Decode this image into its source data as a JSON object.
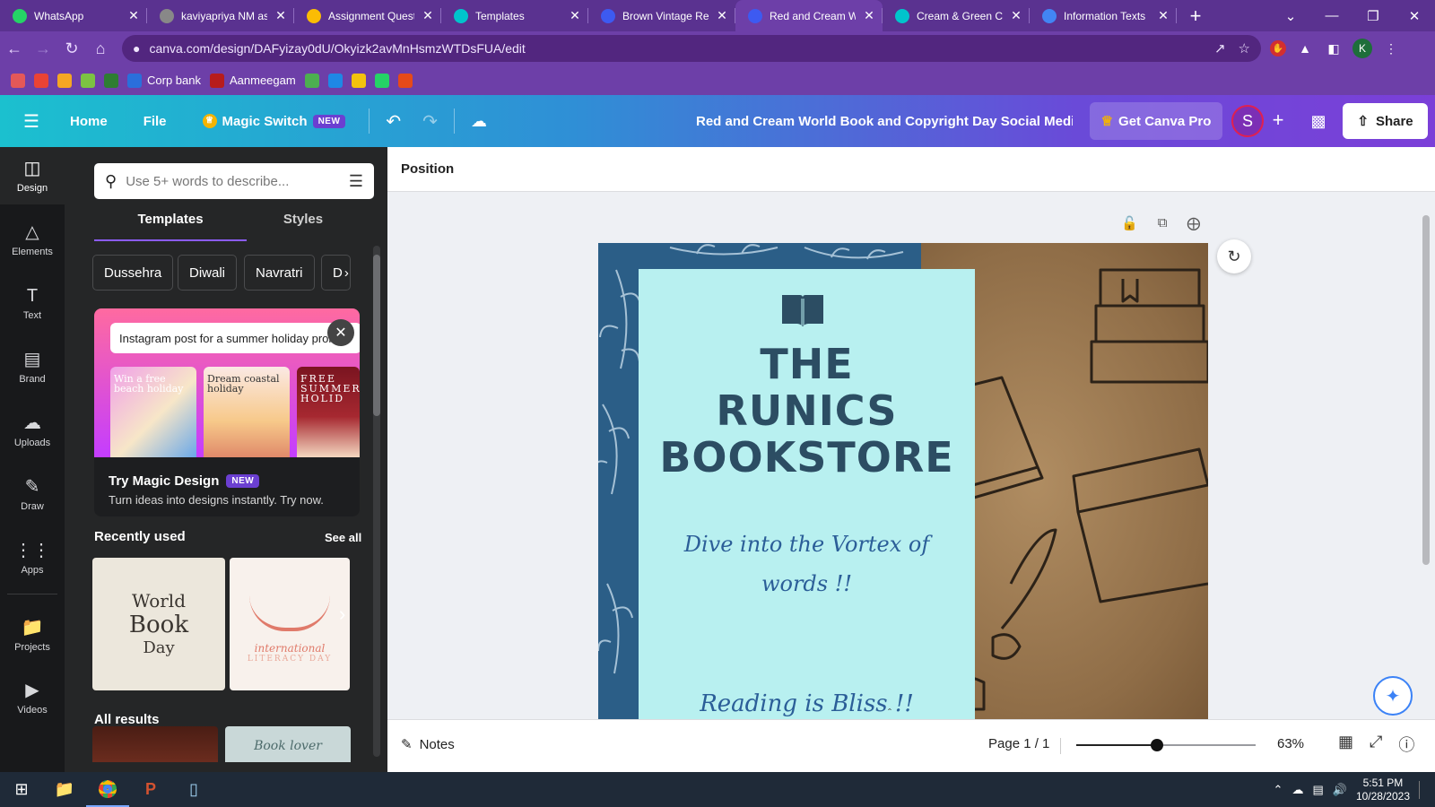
{
  "browser": {
    "tabs": [
      {
        "title": "WhatsApp",
        "icon": "whatsapp-icon",
        "color": "#25d366"
      },
      {
        "title": "kaviyapriya NM as",
        "icon": "globe-icon",
        "color": "#888888"
      },
      {
        "title": "Assignment Quest",
        "icon": "drive-icon",
        "color": "#fbbc04"
      },
      {
        "title": "Templates",
        "icon": "canva-icon",
        "color": "#00c4cc"
      },
      {
        "title": "Brown Vintage Ret",
        "icon": "heart-shield-icon",
        "color": "#3d5af1"
      },
      {
        "title": "Red and Cream W",
        "icon": "heart-shield-icon",
        "color": "#3d5af1",
        "active": true
      },
      {
        "title": "Cream & Green Ca",
        "icon": "canva-icon",
        "color": "#00c4cc"
      },
      {
        "title": "Information Texts",
        "icon": "docs-icon",
        "color": "#4285f4"
      }
    ],
    "url": "canva.com/design/DAFyizay0dU/Okyizk2avMnHsmzWTDsFUA/edit",
    "profile_letter": "K",
    "bookmarks": [
      {
        "label": "",
        "color": "#e45858"
      },
      {
        "label": "",
        "color": "#ea4335"
      },
      {
        "label": "",
        "color": "#f5a623"
      },
      {
        "label": "",
        "color": "#7cc242"
      },
      {
        "label": "",
        "color": "#2e7d32"
      },
      {
        "label": "Corp bank",
        "color": "#2a6fdb"
      },
      {
        "label": "Aanmeegam",
        "color": "#b71c1c"
      },
      {
        "label": "",
        "color": "#4caf50"
      },
      {
        "label": "",
        "color": "#1e88e5"
      },
      {
        "label": "",
        "color": "#f4c20d"
      },
      {
        "label": "",
        "color": "#25d366"
      },
      {
        "label": "",
        "color": "#e64a19"
      }
    ]
  },
  "header": {
    "home": "Home",
    "file": "File",
    "magic_switch": "Magic Switch",
    "new_badge": "NEW",
    "doc_title": "Red and Cream World Book and Copyright Day Social Media...",
    "get_pro": "Get Canva Pro",
    "avatar_letter": "S",
    "share": "Share"
  },
  "rail": [
    {
      "label": "Design",
      "icon": "layout-icon",
      "active": true
    },
    {
      "label": "Elements",
      "icon": "shapes-icon"
    },
    {
      "label": "Text",
      "icon": "text-icon"
    },
    {
      "label": "Brand",
      "icon": "brand-icon"
    },
    {
      "label": "Uploads",
      "icon": "cloud-upload-icon"
    },
    {
      "label": "Draw",
      "icon": "pen-icon"
    },
    {
      "label": "Apps",
      "icon": "apps-grid-icon"
    },
    {
      "label": "Projects",
      "icon": "folder-icon"
    },
    {
      "label": "Videos",
      "icon": "video-icon"
    }
  ],
  "panel": {
    "search_placeholder": "Use 5+ words to describe...",
    "tab_templates": "Templates",
    "tab_styles": "Styles",
    "chips": [
      "Dussehra",
      "Diwali",
      "Navratri",
      "D"
    ],
    "magic_prompt": "Instagram post for a summer holiday promo",
    "magic_thumb1": "Win a free beach holiday",
    "magic_thumb2": "Dream coastal holiday",
    "magic_thumb3": "FREE SUMMER HOLID",
    "magic_title": "Try Magic Design",
    "magic_sub": "Turn ideas into designs instantly. Try now.",
    "recently_used": "Recently used",
    "see_all": "See all",
    "recent1": [
      "World",
      "Book",
      "Day"
    ],
    "recent2": [
      "international",
      "LITERACY DAY"
    ],
    "all_results": "All results",
    "result2_text": "Book lover"
  },
  "editor": {
    "context_label": "Position",
    "design": {
      "headline": [
        "THE",
        "RUNICS",
        "BOOKSTORE"
      ],
      "tagline": "Dive into the Vortex of words !!",
      "tagline2": "Reading is Bliss !!",
      "colors": {
        "strip": "#2b5e87",
        "card": "#b8f0f0",
        "headline": "#2c4d63",
        "tagline": "#2b5e98"
      }
    }
  },
  "bottom": {
    "notes": "Notes",
    "page": "Page 1 / 1",
    "zoom": "63%",
    "zoom_fraction": 0.45
  },
  "taskbar": {
    "time": "5:51 PM",
    "date": "10/28/2023"
  }
}
